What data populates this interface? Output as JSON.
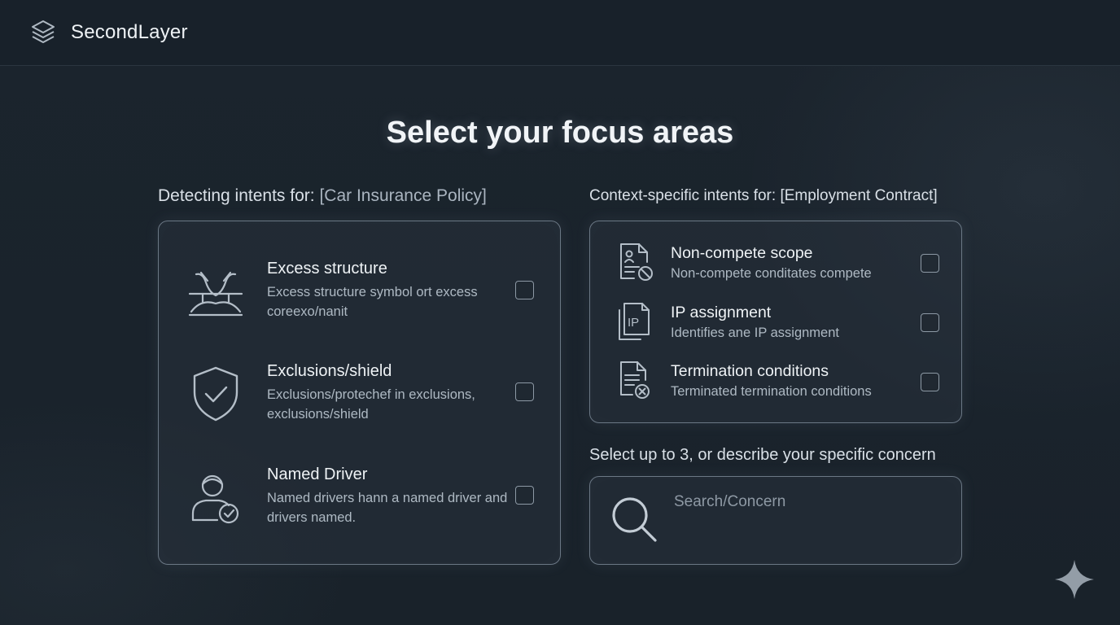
{
  "app": {
    "brand": "SecondLayer"
  },
  "page": {
    "title": "Select your focus areas"
  },
  "left_column": {
    "label_prefix": "Detecting intents for: ",
    "label_value": "[Car Insurance Policy]",
    "items": [
      {
        "title": "Excess structure",
        "desc": "Excess structure symbol ort excess coreexo/nanit",
        "icon": "excess-structure-icon",
        "checked": false
      },
      {
        "title": "Exclusions/shield",
        "desc": "Exclusions/protechef in exclusions, exclusions/shield",
        "icon": "shield-check-icon",
        "checked": false
      },
      {
        "title": "Named Driver",
        "desc": "Named drivers hann a named driver and drivers named.",
        "icon": "driver-check-icon",
        "checked": false
      }
    ]
  },
  "right_column": {
    "label_prefix": "Context-specific intents for: ",
    "label_value": "[Employment Contract]",
    "items": [
      {
        "title": "Non-compete scope",
        "desc": "Non-compete conditates compete",
        "icon": "document-prohibited-icon",
        "checked": false
      },
      {
        "title": "IP assignment",
        "desc": "Identifies ane IP assignment",
        "icon": "ip-document-icon",
        "checked": false
      },
      {
        "title": "Termination conditions",
        "desc": "Terminated termination conditions",
        "icon": "document-cancel-icon",
        "checked": false
      }
    ]
  },
  "concern": {
    "label": "Select up to 3, or describe your specific concern",
    "placeholder": "Search/Concern"
  }
}
